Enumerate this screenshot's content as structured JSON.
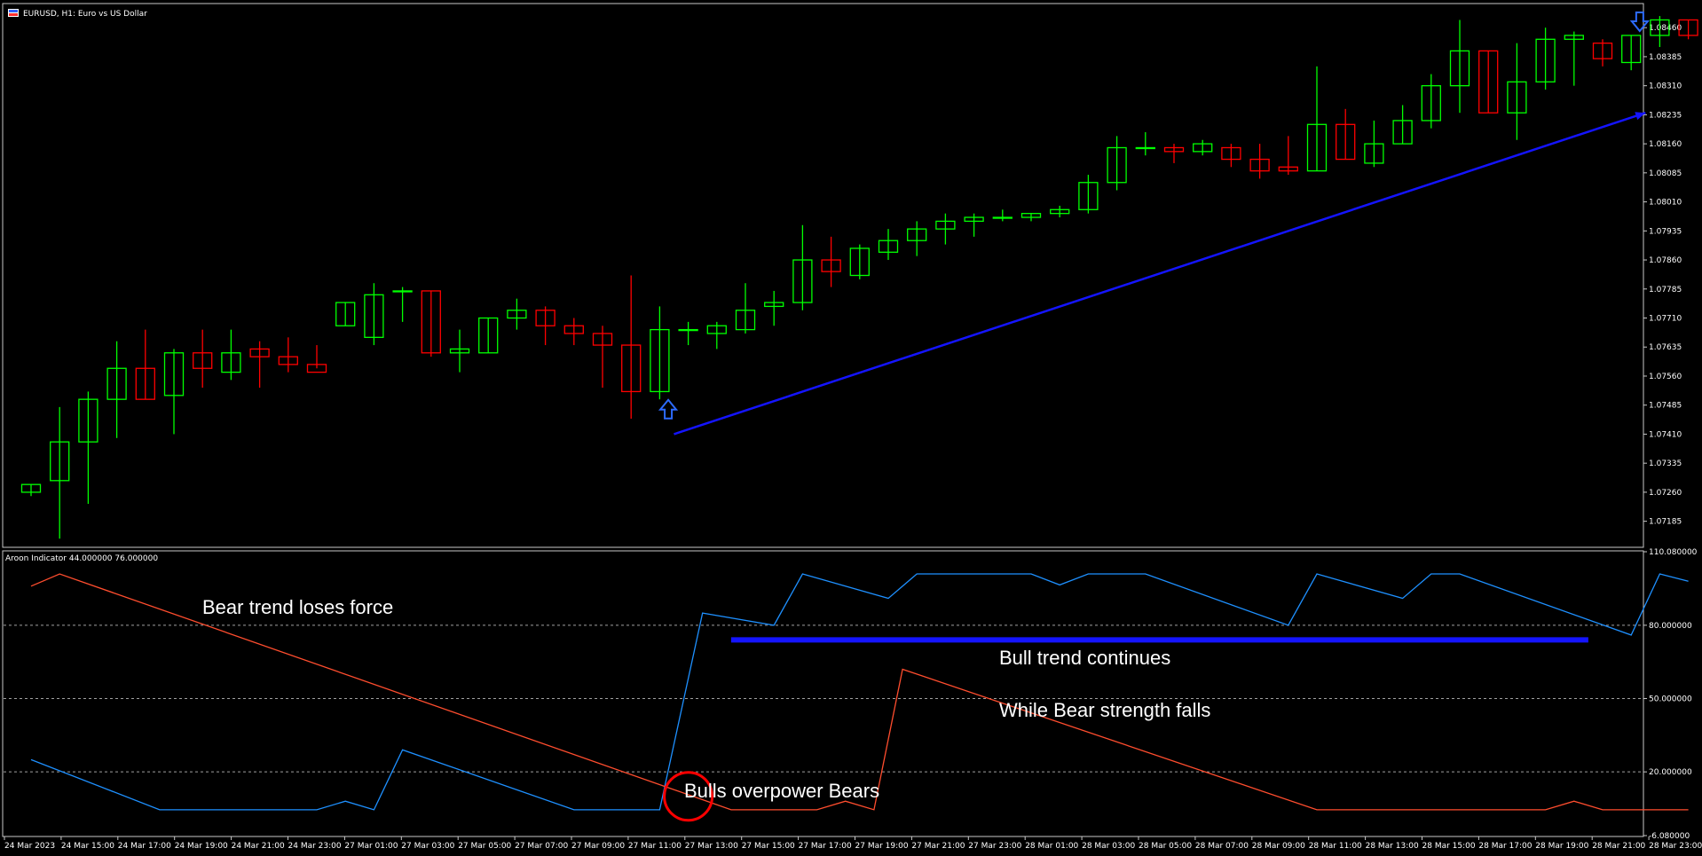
{
  "window": {
    "title": "EURUSD, H1:  Euro vs US Dollar",
    "indicator_label": "Aroon Indicator 44.000000 76.000000"
  },
  "colors": {
    "background": "#000000",
    "frame": "#c8c8c8",
    "bull_candle": "#00ff00",
    "bear_candle": "#ff0000",
    "aroon_up": "#1e90ff",
    "aroon_down": "#ff4d2e",
    "trend_arrow": "#1414ff",
    "marker_circle": "#ff0000",
    "level_lines": "#c8c8c8"
  },
  "annotations": {
    "bear_loses_force": "Bear trend loses force",
    "bull_continues": "Bull trend continues",
    "bear_strength_falls": "While Bear strength falls",
    "bulls_overpower": "Bulls overpower Bears"
  },
  "chart_data": [
    {
      "type": "candlestick",
      "title": "EURUSD, H1:  Euro vs US Dollar",
      "ylim": [
        1.0712,
        1.0852
      ],
      "y_ticks": [
        "1.08460",
        "1.08385",
        "1.08310",
        "1.08235",
        "1.08160",
        "1.08085",
        "1.08010",
        "1.07935",
        "1.07860",
        "1.07785",
        "1.07710",
        "1.07635",
        "1.07560",
        "1.07485",
        "1.07410",
        "1.07335",
        "1.07260",
        "1.07185"
      ],
      "y_tick_values": [
        1.0846,
        1.08385,
        1.0831,
        1.08235,
        1.0816,
        1.08085,
        1.0801,
        1.07935,
        1.0786,
        1.07785,
        1.0771,
        1.07635,
        1.0756,
        1.07485,
        1.0741,
        1.07335,
        1.0726,
        1.07185
      ],
      "x_ticks": [
        "24 Mar 2023",
        "24 Mar 15:00",
        "24 Mar 17:00",
        "24 Mar 19:00",
        "24 Mar 21:00",
        "24 Mar 23:00",
        "27 Mar 01:00",
        "27 Mar 03:00",
        "27 Mar 05:00",
        "27 Mar 07:00",
        "27 Mar 09:00",
        "27 Mar 11:00",
        "27 Mar 13:00",
        "27 Mar 15:00",
        "27 Mar 17:00",
        "27 Mar 19:00",
        "27 Mar 21:00",
        "27 Mar 23:00",
        "28 Mar 01:00",
        "28 Mar 03:00",
        "28 Mar 05:00",
        "28 Mar 07:00",
        "28 Mar 09:00",
        "28 Mar 11:00",
        "28 Mar 13:00",
        "28 Mar 15:00",
        "28 Mar 17:00",
        "28 Mar 19:00",
        "28 Mar 21:00",
        "28 Mar 23:00"
      ],
      "candles": [
        {
          "o": 1.0726,
          "h": 1.0728,
          "l": 1.0725,
          "c": 1.0728
        },
        {
          "o": 1.0729,
          "h": 1.0748,
          "l": 1.0714,
          "c": 1.0739
        },
        {
          "o": 1.0739,
          "h": 1.0752,
          "l": 1.0723,
          "c": 1.075
        },
        {
          "o": 1.075,
          "h": 1.0765,
          "l": 1.074,
          "c": 1.0758
        },
        {
          "o": 1.0758,
          "h": 1.0768,
          "l": 1.075,
          "c": 1.075
        },
        {
          "o": 1.0751,
          "h": 1.0763,
          "l": 1.0741,
          "c": 1.0762
        },
        {
          "o": 1.0762,
          "h": 1.0768,
          "l": 1.0753,
          "c": 1.0758
        },
        {
          "o": 1.0757,
          "h": 1.0768,
          "l": 1.0755,
          "c": 1.0762
        },
        {
          "o": 1.0763,
          "h": 1.0765,
          "l": 1.0753,
          "c": 1.0761
        },
        {
          "o": 1.0761,
          "h": 1.0766,
          "l": 1.0757,
          "c": 1.0759
        },
        {
          "o": 1.0759,
          "h": 1.0764,
          "l": 1.0758,
          "c": 1.0757
        },
        {
          "o": 1.0769,
          "h": 1.0775,
          "l": 1.0769,
          "c": 1.0775
        },
        {
          "o": 1.0766,
          "h": 1.078,
          "l": 1.0764,
          "c": 1.0777
        },
        {
          "o": 1.0778,
          "h": 1.0779,
          "l": 1.077,
          "c": 1.0778
        },
        {
          "o": 1.0778,
          "h": 1.0778,
          "l": 1.0761,
          "c": 1.0762
        },
        {
          "o": 1.0762,
          "h": 1.0768,
          "l": 1.0757,
          "c": 1.0763
        },
        {
          "o": 1.0762,
          "h": 1.0771,
          "l": 1.0762,
          "c": 1.0771
        },
        {
          "o": 1.0771,
          "h": 1.0776,
          "l": 1.0768,
          "c": 1.0773
        },
        {
          "o": 1.0773,
          "h": 1.0774,
          "l": 1.0764,
          "c": 1.0769
        },
        {
          "o": 1.0769,
          "h": 1.0771,
          "l": 1.0764,
          "c": 1.0767
        },
        {
          "o": 1.0767,
          "h": 1.0769,
          "l": 1.0753,
          "c": 1.0764
        },
        {
          "o": 1.0764,
          "h": 1.0782,
          "l": 1.0745,
          "c": 1.0752
        },
        {
          "o": 1.0752,
          "h": 1.0774,
          "l": 1.075,
          "c": 1.0768
        },
        {
          "o": 1.0768,
          "h": 1.077,
          "l": 1.0764,
          "c": 1.0768
        },
        {
          "o": 1.0767,
          "h": 1.077,
          "l": 1.0763,
          "c": 1.0769
        },
        {
          "o": 1.0768,
          "h": 1.078,
          "l": 1.0767,
          "c": 1.0773
        },
        {
          "o": 1.0774,
          "h": 1.0778,
          "l": 1.0769,
          "c": 1.0775
        },
        {
          "o": 1.0775,
          "h": 1.0795,
          "l": 1.0773,
          "c": 1.0786
        },
        {
          "o": 1.0786,
          "h": 1.0792,
          "l": 1.0779,
          "c": 1.0783
        },
        {
          "o": 1.0782,
          "h": 1.079,
          "l": 1.0781,
          "c": 1.0789
        },
        {
          "o": 1.0788,
          "h": 1.0794,
          "l": 1.0786,
          "c": 1.0791
        },
        {
          "o": 1.0791,
          "h": 1.0796,
          "l": 1.0787,
          "c": 1.0794
        },
        {
          "o": 1.0794,
          "h": 1.0798,
          "l": 1.079,
          "c": 1.0796
        },
        {
          "o": 1.0796,
          "h": 1.0798,
          "l": 1.0792,
          "c": 1.0797
        },
        {
          "o": 1.0797,
          "h": 1.0799,
          "l": 1.0796,
          "c": 1.0797
        },
        {
          "o": 1.0797,
          "h": 1.0798,
          "l": 1.0796,
          "c": 1.0798
        },
        {
          "o": 1.0798,
          "h": 1.08,
          "l": 1.0797,
          "c": 1.0799
        },
        {
          "o": 1.0799,
          "h": 1.0808,
          "l": 1.0798,
          "c": 1.0806
        },
        {
          "o": 1.0806,
          "h": 1.0818,
          "l": 1.0804,
          "c": 1.0815
        },
        {
          "o": 1.0815,
          "h": 1.0819,
          "l": 1.0813,
          "c": 1.0815
        },
        {
          "o": 1.0815,
          "h": 1.0816,
          "l": 1.0811,
          "c": 1.0814
        },
        {
          "o": 1.0814,
          "h": 1.0817,
          "l": 1.0813,
          "c": 1.0816
        },
        {
          "o": 1.0815,
          "h": 1.0816,
          "l": 1.081,
          "c": 1.0812
        },
        {
          "o": 1.0812,
          "h": 1.0816,
          "l": 1.0807,
          "c": 1.0809
        },
        {
          "o": 1.081,
          "h": 1.0818,
          "l": 1.0808,
          "c": 1.0809
        },
        {
          "o": 1.0809,
          "h": 1.0836,
          "l": 1.0809,
          "c": 1.0821
        },
        {
          "o": 1.0821,
          "h": 1.0825,
          "l": 1.0812,
          "c": 1.0812
        },
        {
          "o": 1.0811,
          "h": 1.0822,
          "l": 1.081,
          "c": 1.0816
        },
        {
          "o": 1.0816,
          "h": 1.0826,
          "l": 1.0816,
          "c": 1.0822
        },
        {
          "o": 1.0822,
          "h": 1.0834,
          "l": 1.082,
          "c": 1.0831
        },
        {
          "o": 1.0831,
          "h": 1.0848,
          "l": 1.0824,
          "c": 1.084
        },
        {
          "o": 1.084,
          "h": 1.084,
          "l": 1.0824,
          "c": 1.0824
        },
        {
          "o": 1.0824,
          "h": 1.0842,
          "l": 1.0817,
          "c": 1.0832
        },
        {
          "o": 1.0832,
          "h": 1.0846,
          "l": 1.083,
          "c": 1.0843
        },
        {
          "o": 1.0843,
          "h": 1.0845,
          "l": 1.0831,
          "c": 1.0844
        },
        {
          "o": 1.0842,
          "h": 1.0843,
          "l": 1.0836,
          "c": 1.0838
        },
        {
          "o": 1.0837,
          "h": 1.0844,
          "l": 1.0835,
          "c": 1.0844
        },
        {
          "o": 1.0844,
          "h": 1.0849,
          "l": 1.0841,
          "c": 1.0848
        },
        {
          "o": 1.0848,
          "h": 1.0848,
          "l": 1.0843,
          "c": 1.0844
        }
      ],
      "up_arrow_price": 1.0751,
      "down_arrow_price": 1.0847,
      "trend_arrow": {
        "from_bar": 22.5,
        "from_price": 1.0741,
        "to_bar": 56.5,
        "to_price": 1.0824
      }
    },
    {
      "type": "line",
      "title": "Aroon Indicator 44.000000 76.000000",
      "ylim": [
        -6.08,
        110.08
      ],
      "y_ticks": [
        "110.080000",
        "80.000000",
        "50.000000",
        "20.000000",
        "-6.080000"
      ],
      "y_tick_values": [
        110.08,
        80,
        50,
        20,
        -6.08
      ],
      "levels": [
        80,
        50,
        20
      ],
      "series": [
        {
          "name": "",
          "points": [
            [
              0,
              25
            ],
            [
              4.5,
              4.5
            ],
            [
              10,
              4.5
            ],
            [
              11,
              8
            ],
            [
              12,
              4.5
            ],
            [
              13,
              29
            ],
            [
              19,
              4.5
            ],
            [
              22,
              4.5
            ],
            [
              23.5,
              85
            ],
            [
              26,
              80
            ],
            [
              27,
              101
            ],
            [
              30,
              91
            ],
            [
              31,
              101
            ],
            [
              35,
              101
            ],
            [
              36,
              96.5
            ],
            [
              37,
              101
            ],
            [
              39,
              101
            ],
            [
              44,
              80
            ],
            [
              45,
              101
            ],
            [
              48,
              91
            ],
            [
              49,
              101
            ],
            [
              50,
              101
            ],
            [
              56,
              76
            ],
            [
              57,
              101
            ],
            [
              58,
              98
            ]
          ]
        },
        {
          "name": "",
          "points": [
            [
              0,
              96
            ],
            [
              1,
              101
            ],
            [
              24.5,
              4.5
            ],
            [
              27.5,
              4.5
            ],
            [
              28.5,
              8
            ],
            [
              29.5,
              4.5
            ],
            [
              30.5,
              62
            ],
            [
              45,
              4.5
            ],
            [
              53,
              4.5
            ],
            [
              54,
              8
            ],
            [
              55,
              4.5
            ],
            [
              58,
              4.5
            ]
          ]
        }
      ],
      "bull_bar": {
        "from_bar": 24.5,
        "to_bar": 54.5,
        "value": 74
      },
      "circle_at": {
        "bar": 23,
        "value": 10
      }
    }
  ]
}
